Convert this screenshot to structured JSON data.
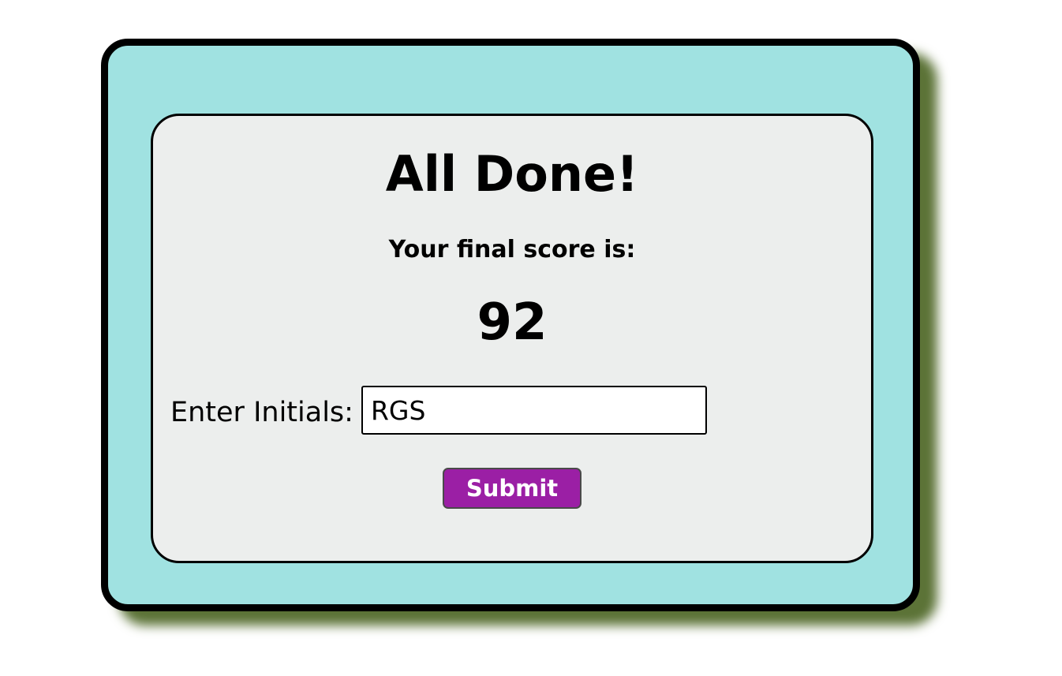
{
  "quiz_end": {
    "title": "All Done!",
    "score_label": "Your final score is:",
    "score_value": "92",
    "initials_label": "Enter Initials:",
    "initials_value": "RGS",
    "submit_label": "Submit"
  },
  "colors": {
    "outer_background": "#a0e2e1",
    "panel_background": "#eceeed",
    "shadow": "#5c7337",
    "submit_button": "#9b1fa5"
  }
}
